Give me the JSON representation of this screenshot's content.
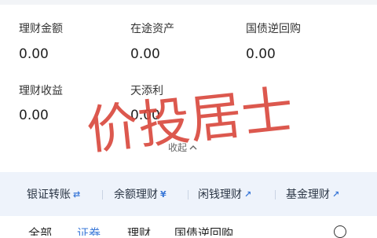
{
  "stats": {
    "wealth_amount": {
      "label": "理财金额",
      "value": "0.00"
    },
    "in_transit_assets": {
      "label": "在途资产",
      "value": "0.00"
    },
    "treasury_reverse_repo": {
      "label": "国债逆回购",
      "value": "0.00"
    },
    "wealth_income": {
      "label": "理财收益",
      "value": "0.00"
    },
    "tiantianli": {
      "label": "天添利",
      "value": "0.00"
    }
  },
  "collapse_label": "收起",
  "watermark_text": "价投居士",
  "actions": [
    {
      "label": "银证转账",
      "icon": "transfer-icon",
      "glyph": "⇄"
    },
    {
      "label": "余额理财",
      "icon": "yen-icon",
      "glyph": "¥"
    },
    {
      "label": "闲钱理财",
      "icon": "trend-icon",
      "glyph": "↗"
    },
    {
      "label": "基金理财",
      "icon": "trend-up-icon",
      "glyph": "↗"
    }
  ],
  "tabs": [
    {
      "label": "全部"
    },
    {
      "label": "证券"
    },
    {
      "label": "理财"
    },
    {
      "label": "国债逆回购"
    }
  ],
  "colors": {
    "accent": "#3a78d8",
    "action_bar_bg": "#eef3fb",
    "watermark": "#d9463b"
  }
}
